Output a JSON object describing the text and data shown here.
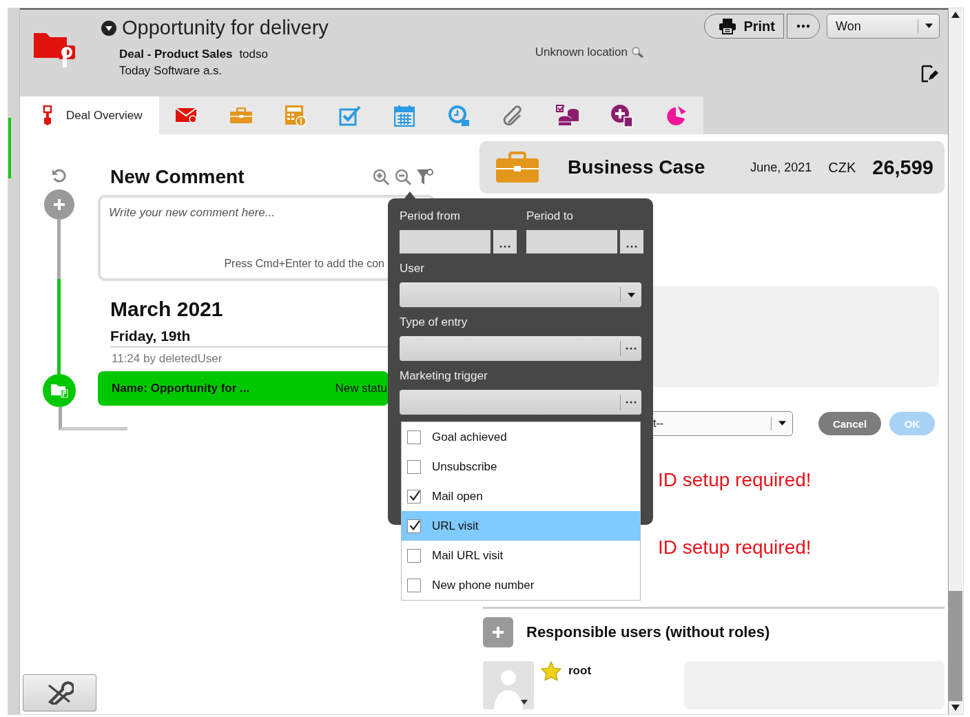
{
  "header": {
    "title": "Opportunity for delivery",
    "deal_type": "Deal - Product Sales",
    "owner": "todso",
    "company": "Today Software a.s.",
    "location": "Unknown location",
    "print_button": "Print",
    "status_select": "Won"
  },
  "tabs": [
    {
      "kind": "overview",
      "label": "Deal Overview",
      "selected": true
    },
    {
      "kind": "mail",
      "selected": false
    },
    {
      "kind": "briefcase",
      "selected": false
    },
    {
      "kind": "calculator",
      "selected": false
    },
    {
      "kind": "task",
      "selected": false
    },
    {
      "kind": "calendar",
      "selected": false
    },
    {
      "kind": "clock",
      "selected": false
    },
    {
      "kind": "attachment",
      "selected": false
    },
    {
      "kind": "coins",
      "selected": false
    },
    {
      "kind": "addmoney",
      "selected": false
    },
    {
      "kind": "pie",
      "selected": false
    }
  ],
  "timeline": {
    "new_comment_title": "New Comment",
    "comment_placeholder": "Write your new comment here...",
    "comment_hint": "Press Cmd+Enter to add the con",
    "month": "March 2021",
    "day": "Friday, 19th",
    "entry_meta": "11:24 by deletedUser",
    "entry_name": "Name: Opportunity for ...",
    "entry_status": "New statu"
  },
  "business_case": {
    "title": "Business Case",
    "date": "June, 2021",
    "currency": "CZK",
    "amount": "26,599"
  },
  "form_row": {
    "select_value": "t--",
    "cancel": "Cancel",
    "ok": "OK",
    "ok_disabled": true
  },
  "warnings": [
    "ID setup required!",
    "ID setup required!"
  ],
  "responsible": {
    "title": "Responsible users (without roles)",
    "users": [
      {
        "name": "root",
        "starred": true
      }
    ]
  },
  "filter_popup": {
    "fields": [
      {
        "kind": "date_pair",
        "items": [
          {
            "label": "Period from"
          },
          {
            "label": "Period to"
          }
        ]
      },
      {
        "kind": "select",
        "label": "User"
      },
      {
        "kind": "picker",
        "label": "Type of entry"
      },
      {
        "kind": "picker",
        "label": "Marketing trigger"
      }
    ],
    "trigger_options": [
      {
        "label": "Goal achieved",
        "checked": false,
        "selected": false
      },
      {
        "label": "Unsubscribe",
        "checked": false,
        "selected": false
      },
      {
        "label": "Mail open",
        "checked": true,
        "selected": false
      },
      {
        "label": "URL visit",
        "checked": true,
        "selected": true
      },
      {
        "label": "Mail URL visit",
        "checked": false,
        "selected": false
      },
      {
        "label": "New phone number",
        "checked": false,
        "selected": false
      }
    ]
  }
}
